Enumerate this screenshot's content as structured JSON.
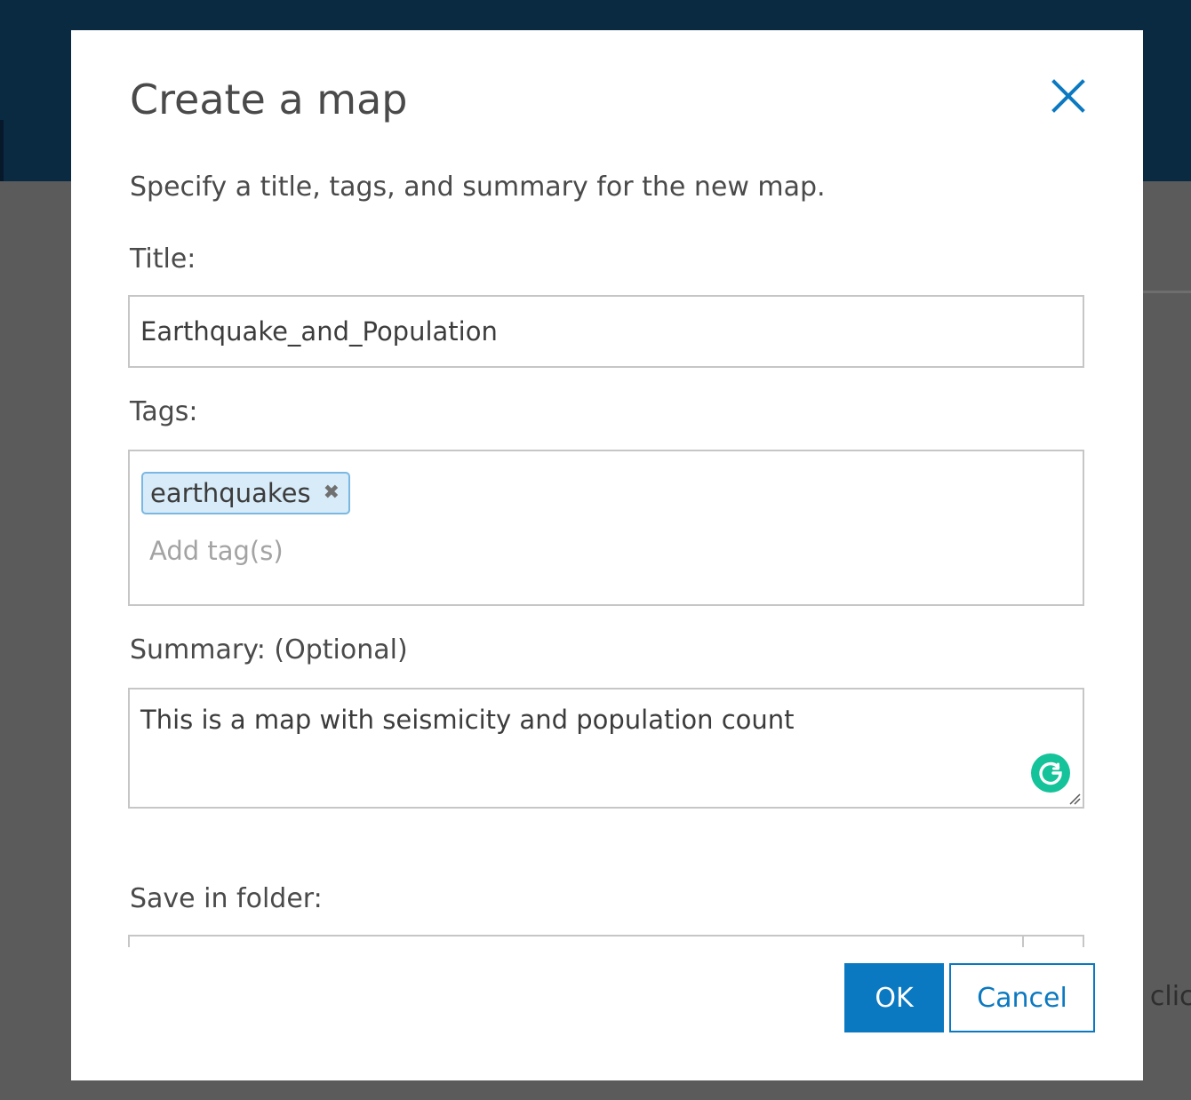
{
  "background": {
    "partial_text": "r clic"
  },
  "modal": {
    "title": "Create a map",
    "close_icon": "close-icon",
    "instructions": "Specify a title, tags, and summary for the new map.",
    "title_field": {
      "label": "Title:",
      "value": "Earthquake_and_Population"
    },
    "tags_field": {
      "label": "Tags:",
      "tags": [
        {
          "text": "earthquakes",
          "remove_glyph": "✖"
        }
      ],
      "placeholder": "Add tag(s)"
    },
    "summary_field": {
      "label": "Summary: (Optional)",
      "value": "This is a map with seismicity and population count",
      "assistant_icon": "grammarly-icon"
    },
    "folder_field": {
      "label": "Save in folder:"
    },
    "buttons": {
      "ok": "OK",
      "cancel": "Cancel"
    },
    "colors": {
      "primary": "#0b79c1",
      "tag_background": "#d7ebf8",
      "tag_border": "#7ab8e3",
      "grammarly": "#15c39a",
      "header_background": "#0a2a42"
    }
  }
}
